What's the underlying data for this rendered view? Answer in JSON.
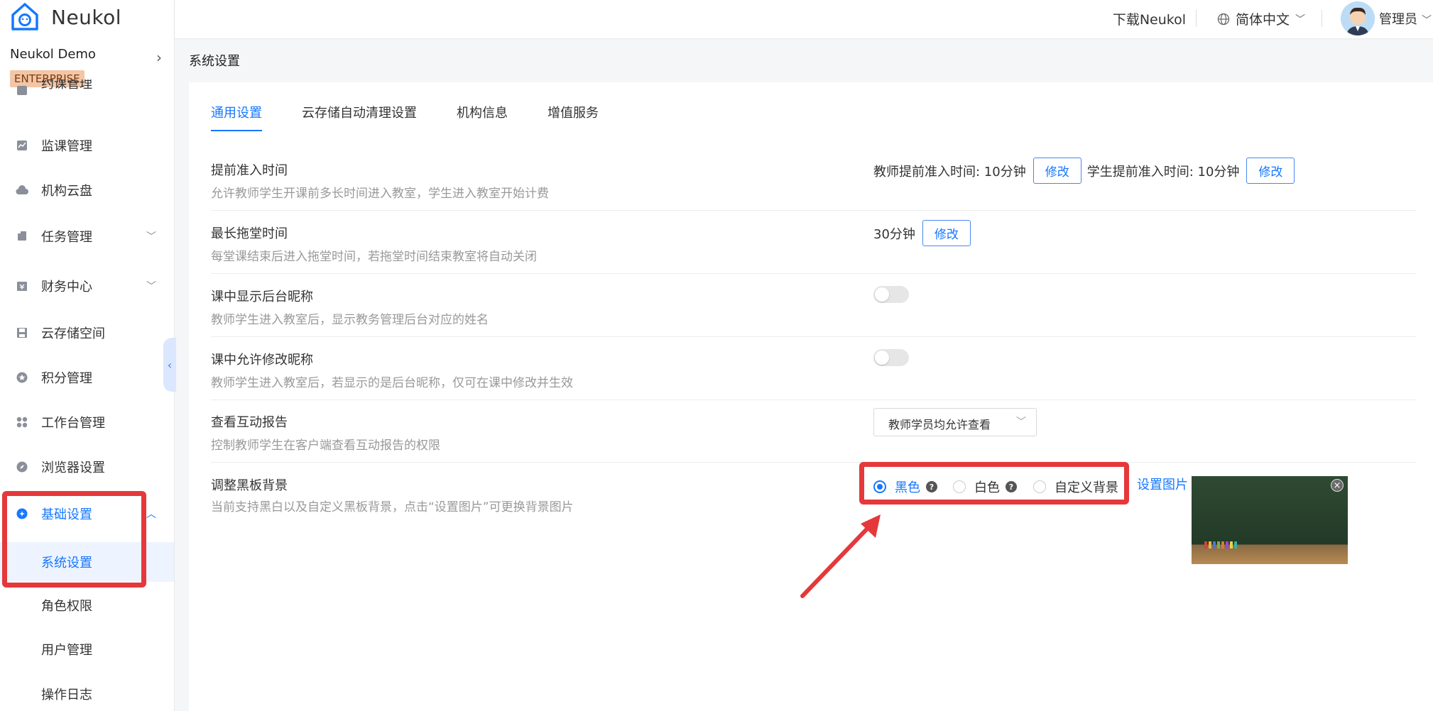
{
  "app": {
    "name": "Neukol"
  },
  "org": {
    "name": "Neukol Demo",
    "badge": "ENTERPRISE"
  },
  "sidebar": {
    "items": [
      {
        "label": "约课管理",
        "icon": "calendar-icon"
      },
      {
        "label": "监课管理",
        "icon": "chart-icon"
      },
      {
        "label": "机构云盘",
        "icon": "cloud-icon"
      },
      {
        "label": "任务管理",
        "icon": "task-icon"
      },
      {
        "label": "财务中心",
        "icon": "finance-icon"
      },
      {
        "label": "云存储空间",
        "icon": "storage-icon"
      },
      {
        "label": "积分管理",
        "icon": "points-icon"
      },
      {
        "label": "工作台管理",
        "icon": "grid-icon"
      },
      {
        "label": "浏览器设置",
        "icon": "compass-icon"
      },
      {
        "label": "基础设置",
        "icon": "settings-circle-icon"
      },
      {
        "label": "系统设置"
      },
      {
        "label": "角色权限"
      },
      {
        "label": "用户管理"
      },
      {
        "label": "操作日志"
      }
    ]
  },
  "header": {
    "download": "下载Neukol",
    "language": "简体中文",
    "user": "管理员"
  },
  "breadcrumb": "系统设置",
  "tabs": [
    "通用设置",
    "云存储自动清理设置",
    "机构信息",
    "增值服务"
  ],
  "settings": {
    "early_entry": {
      "title": "提前准入时间",
      "desc": "允许教师学生开课前多长时间进入教室，学生进入教室开始计费",
      "teacher": "教师提前准入时间: 10分钟",
      "student": "学生提前准入时间: 10分钟",
      "edit": "修改"
    },
    "max_overtime": {
      "title": "最长拖堂时间",
      "desc": "每堂课结束后进入拖堂时间，若拖堂时间结束教室将自动关闭",
      "value": "30分钟",
      "edit": "修改"
    },
    "show_nickname": {
      "title": "课中显示后台昵称",
      "desc": "教师学生进入教室后，显示教务管理后台对应的姓名",
      "enabled": false
    },
    "allow_rename": {
      "title": "课中允许修改昵称",
      "desc": "教师学生进入教室后，若显示的是后台昵称，仅可在课中修改并生效",
      "enabled": false
    },
    "report": {
      "title": "查看互动报告",
      "desc": "控制教师学生在客户端查看互动报告的权限",
      "value": "教师学员均允许查看"
    },
    "blackboard": {
      "title": "调整黑板背景",
      "desc": "当前支持黑白以及自定义黑板背景，点击“设置图片”可更换背景图片",
      "options": [
        "黑色",
        "白色",
        "自定义背景"
      ],
      "selected": "黑色",
      "set_image": "设置图片",
      "help": "?",
      "close": "×"
    }
  },
  "colors": {
    "accent": "#1677ff",
    "highlight": "#e5383b"
  }
}
